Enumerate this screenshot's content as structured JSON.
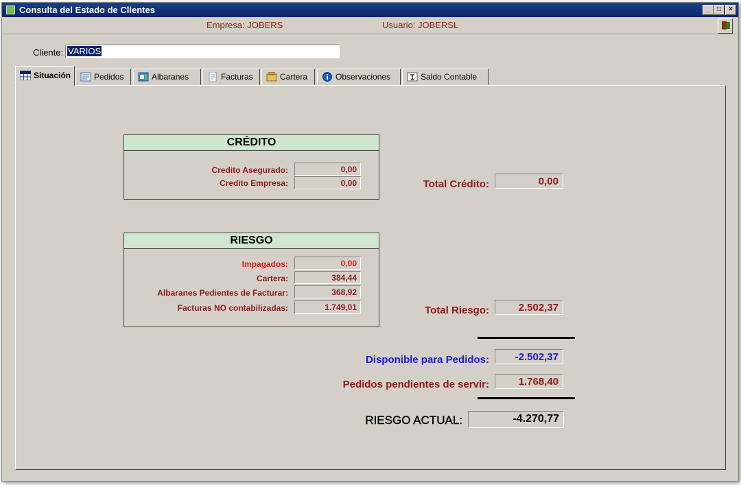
{
  "window": {
    "title": "Consulta del Estado de Clientes",
    "controls": [
      "_",
      "□",
      "×"
    ]
  },
  "infobar": {
    "empresa": "Empresa: JOBERS",
    "usuario": "Usuario: JOBERSL"
  },
  "cliente": {
    "label": "Cliente:",
    "value": "VARIOS"
  },
  "tabs": [
    {
      "label": "Situación",
      "icon": "grid-icon",
      "active": true
    },
    {
      "label": "Pedidos",
      "icon": "orders-icon"
    },
    {
      "label": "Albaranes",
      "icon": "delivery-icon"
    },
    {
      "label": "Facturas",
      "icon": "invoice-icon"
    },
    {
      "label": "Cartera",
      "icon": "wallet-icon"
    },
    {
      "label": "Observaciones",
      "icon": "info-icon"
    },
    {
      "label": "Saldo Contable",
      "icon": "balance-icon"
    }
  ],
  "credito": {
    "title": "CRÉDITO",
    "asegurado_label": "Credito Asegurado:",
    "asegurado_value": "0,00",
    "empresa_label": "Credito Empresa:",
    "empresa_value": "0,00"
  },
  "riesgo": {
    "title": "RIESGO",
    "impagados_label": "Impagados:",
    "impagados_value": "0,00",
    "cartera_label": "Cartera:",
    "cartera_value": "384,44",
    "albaranes_label": "Albaranes Pedientes de Facturar:",
    "albaranes_value": "368,92",
    "facturas_label": "Facturas NO contabilizadas:",
    "facturas_value": "1.749,01"
  },
  "totals": {
    "total_credito_label": "Total Crédito:",
    "total_credito_value": "0,00",
    "total_riesgo_label": "Total Riesgo:",
    "total_riesgo_value": "2.502,37",
    "disponible_label": "Disponible para Pedidos:",
    "disponible_value": "-2.502,37",
    "pedidos_label": "Pedidos pendientes de servir:",
    "pedidos_value": "1.768,40",
    "riesgo_actual_label": "RIESGO ACTUAL:",
    "riesgo_actual_value": "-4.270,77"
  },
  "colors": {
    "titlebar": "#0a246a",
    "label_maroon": "#8b1a1a",
    "label_red": "#e01818",
    "label_blue": "#1a1acb",
    "group_header": "#cfe7cf"
  }
}
